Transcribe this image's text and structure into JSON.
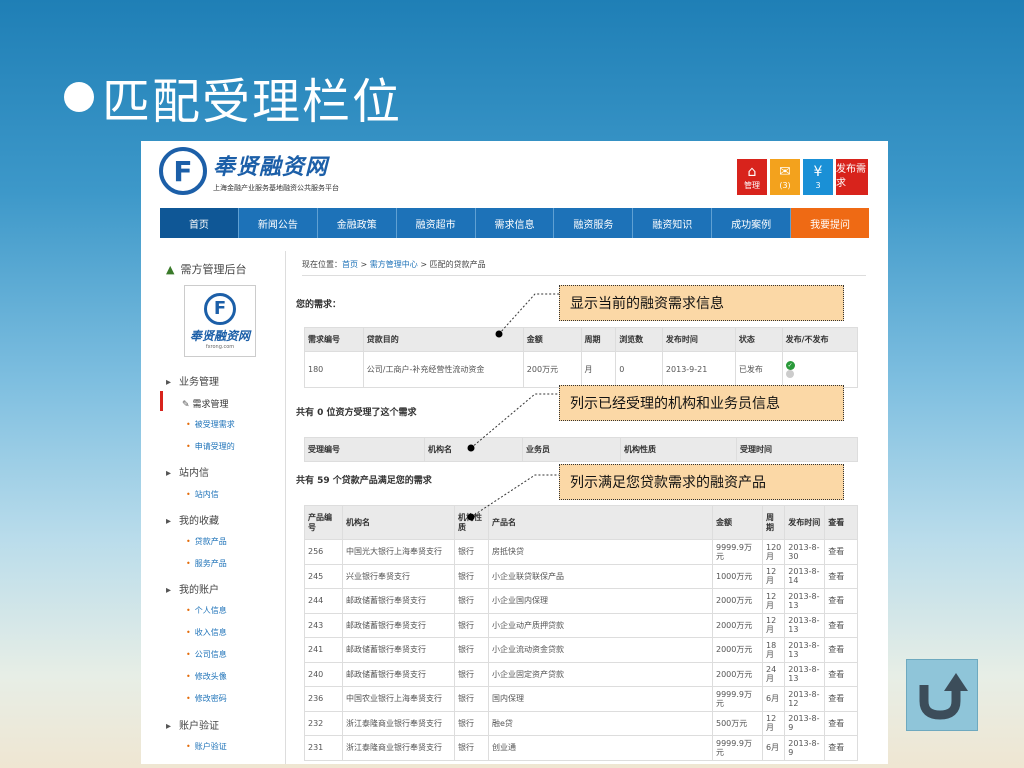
{
  "slide_title": "匹配受理栏位",
  "site": {
    "logo_letter": "F",
    "name": "奉贤融资网",
    "slogan": "上海金融产业服务基地融资公共服务平台",
    "sidebar_logo_url": "fxrong.com"
  },
  "header_buttons": [
    {
      "icon": "home-icon",
      "glyph": "⌂",
      "label": "管理"
    },
    {
      "icon": "mail-icon",
      "glyph": "✉",
      "label": "(3)"
    },
    {
      "icon": "yen-icon",
      "glyph": "¥",
      "label": "3"
    },
    {
      "icon": "",
      "glyph": "",
      "label": "发布需求"
    }
  ],
  "nav": [
    "首页",
    "新闻公告",
    "金融政策",
    "融资超市",
    "需求信息",
    "融资服务",
    "融资知识",
    "成功案例",
    "我要提问"
  ],
  "sidebar": {
    "title": "需方管理后台",
    "groups": [
      {
        "label": "业务管理",
        "items": [
          "需求管理",
          "被受理需求",
          "申请受理的"
        ]
      },
      {
        "label": "站内信",
        "items": [
          "站内信"
        ]
      },
      {
        "label": "我的收藏",
        "items": [
          "贷款产品",
          "服务产品"
        ]
      },
      {
        "label": "我的账户",
        "items": [
          "个人信息",
          "收入信息",
          "公司信息",
          "修改头像",
          "修改密码"
        ]
      },
      {
        "label": "账户验证",
        "items": [
          "账户验证"
        ]
      }
    ]
  },
  "breadcrumb": {
    "prefix": "现在位置：",
    "home": "首页",
    "sep": " > ",
    "center": "需方管理中心",
    "current": "匹配的贷款产品"
  },
  "demand_section": {
    "label": "您的需求：",
    "headers": [
      "需求编号",
      "贷款目的",
      "金额",
      "周期",
      "浏览数",
      "发布时间",
      "状态",
      "发布/不发布"
    ],
    "row": {
      "id": "180",
      "purpose": "公司/工商户-补充经营性流动资金",
      "amount": "200万元",
      "period": "月",
      "views": "0",
      "date": "2013-9-21",
      "status": "已发布"
    }
  },
  "accepted_section": {
    "label": "共有 0 位资方受理了这个需求",
    "headers": [
      "受理编号",
      "机构名",
      "业务员",
      "机构性质",
      "受理时间"
    ]
  },
  "products_section": {
    "label": "共有 59 个贷款产品满足您的需求",
    "headers": [
      "产品编号",
      "机构名",
      "机构性质",
      "产品名",
      "金额",
      "周期",
      "发布时间",
      "查看"
    ],
    "rows": [
      {
        "id": "256",
        "org": "中国光大银行上海奉贤支行",
        "type": "银行",
        "name": "房抵快贷",
        "amount": "9999.9万元",
        "period": "120月",
        "date": "2013-8-30",
        "view": "查看"
      },
      {
        "id": "245",
        "org": "兴业银行奉贤支行",
        "type": "银行",
        "name": "小企业联贷联保产品",
        "amount": "1000万元",
        "period": "12月",
        "date": "2013-8-14",
        "view": "查看"
      },
      {
        "id": "244",
        "org": "邮政储蓄银行奉贤支行",
        "type": "银行",
        "name": "小企业国内保理",
        "amount": "2000万元",
        "period": "12月",
        "date": "2013-8-13",
        "view": "查看"
      },
      {
        "id": "243",
        "org": "邮政储蓄银行奉贤支行",
        "type": "银行",
        "name": "小企业动产质押贷款",
        "amount": "2000万元",
        "period": "12月",
        "date": "2013-8-13",
        "view": "查看"
      },
      {
        "id": "241",
        "org": "邮政储蓄银行奉贤支行",
        "type": "银行",
        "name": "小企业流动资金贷款",
        "amount": "2000万元",
        "period": "18月",
        "date": "2013-8-13",
        "view": "查看"
      },
      {
        "id": "240",
        "org": "邮政储蓄银行奉贤支行",
        "type": "银行",
        "name": "小企业固定资产贷款",
        "amount": "2000万元",
        "period": "24月",
        "date": "2013-8-13",
        "view": "查看"
      },
      {
        "id": "236",
        "org": "中国农业银行上海奉贤支行",
        "type": "银行",
        "name": "国内保理",
        "amount": "9999.9万元",
        "period": "6月",
        "date": "2013-8-12",
        "view": "查看"
      },
      {
        "id": "232",
        "org": "浙江泰隆商业银行奉贤支行",
        "type": "银行",
        "name": "融e贷",
        "amount": "500万元",
        "period": "12月",
        "date": "2013-8-9",
        "view": "查看"
      },
      {
        "id": "231",
        "org": "浙江泰隆商业银行奉贤支行",
        "type": "银行",
        "name": "创业通",
        "amount": "9999.9万元",
        "period": "6月",
        "date": "2013-8-9",
        "view": "查看"
      }
    ]
  },
  "callouts": [
    "显示当前的融资需求信息",
    "列示已经受理的机构和业务员信息",
    "列示满足您贷款需求的融资产品"
  ],
  "back_button": {
    "icon": "u-turn-icon"
  },
  "colors": {
    "nav_blue": "#1d72b8",
    "nav_active": "#0f5796",
    "nav_orange": "#ef6a14",
    "brand_blue": "#1c5fa8",
    "callout_bg": "#fbd8a6"
  }
}
